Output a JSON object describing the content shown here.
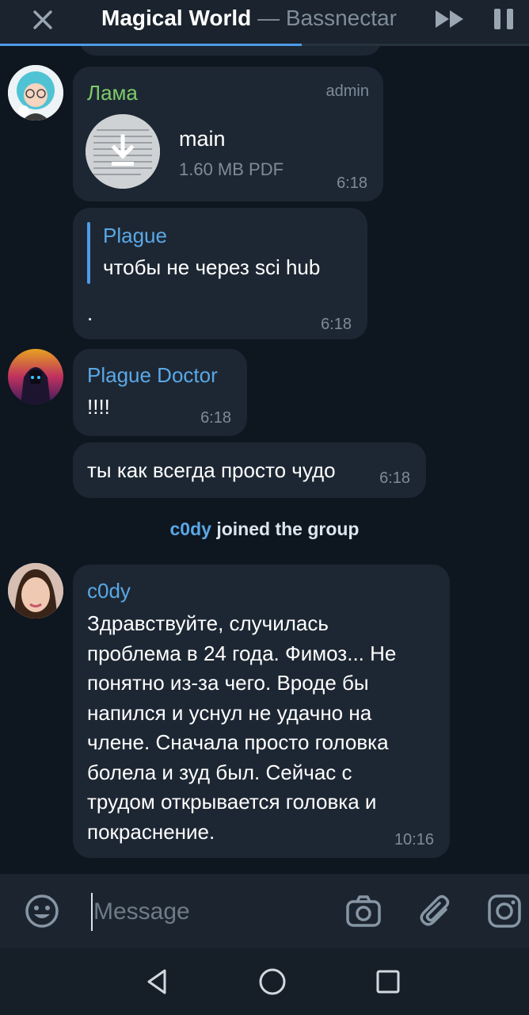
{
  "player": {
    "track": "Magical World",
    "separator": " — ",
    "artist": "Bassnectar",
    "progress": 0.57
  },
  "messages": {
    "m1": {
      "sender": "Лама",
      "sender_color": "#7ecb6a",
      "role": "admin",
      "file_name": "main",
      "file_info": "1.60 MB PDF",
      "time": "6:18"
    },
    "m2": {
      "reply_name": "Plague",
      "reply_text": "чтобы не через sci hub",
      "text": ".",
      "time": "6:18"
    },
    "m3": {
      "sender": "Plague Doctor",
      "sender_color": "#5aa8e6",
      "text": "!!!!",
      "time": "6:18"
    },
    "m4": {
      "text": "ты как всегда просто чудо",
      "time": "6:18"
    },
    "service": {
      "user": "c0dy",
      "action": "joined the group"
    },
    "m5": {
      "sender": "c0dy",
      "sender_color": "#5aa8e6",
      "lines": [
        "Здравствуйте, случилась",
        "проблема в 24 года. Фимоз... Не",
        "понятно из-за чего. Вроде бы",
        "напился и уснул не удачно на",
        "члене. Сначала просто головка",
        "болела и зуд был. Сейчас с",
        "трудом открывается головка и",
        "покраснение."
      ],
      "time": "10:16"
    }
  },
  "input": {
    "placeholder": "Message"
  },
  "icons": {
    "close": "close-icon",
    "fast_forward": "fast-forward-icon",
    "pause": "pause-icon",
    "download": "download-icon",
    "emoji": "emoji-icon",
    "camera": "camera-icon",
    "attach": "paperclip-icon",
    "instagram": "instagram-icon",
    "back": "nav-back-icon",
    "home": "nav-home-icon",
    "recents": "nav-recents-icon"
  },
  "colors": {
    "background": "#0e1620",
    "bubble": "#1d2733",
    "accent": "#4f9be8",
    "time": "#7e8b98"
  }
}
